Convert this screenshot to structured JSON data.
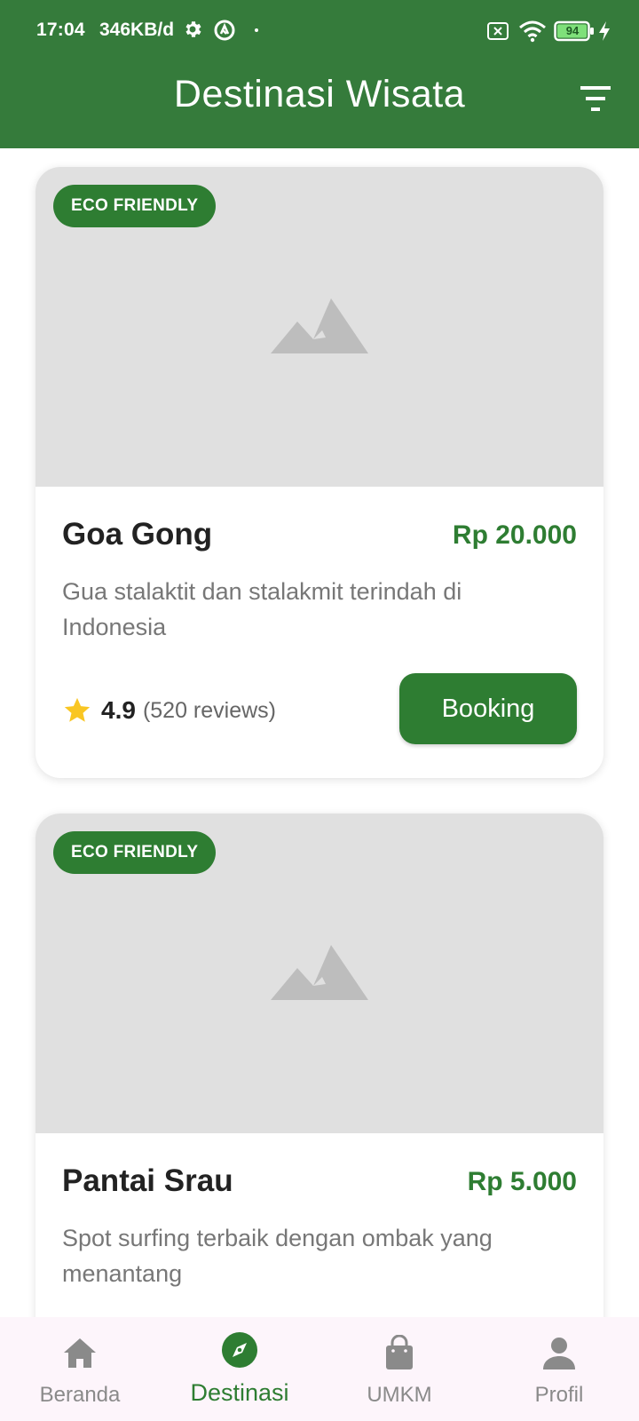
{
  "status_bar": {
    "time": "17:04",
    "speed": "346KB/d",
    "battery": "94"
  },
  "app_bar": {
    "title": "Destinasi Wisata",
    "filter_icon": "filter-list-icon",
    "color": "#357b3b"
  },
  "destinations": [
    {
      "badge": "ECO FRIENDLY",
      "name": "Goa Gong",
      "price": "Rp 20.000",
      "description": "Gua stalaktit dan stalakmit terindah di Indonesia",
      "rating": "4.9",
      "reviews": "(520 reviews)",
      "button": "Booking"
    },
    {
      "badge": "ECO FRIENDLY",
      "name": "Pantai Srau",
      "price": "Rp 5.000",
      "description": "Spot surfing terbaik dengan ombak yang menantang"
    }
  ],
  "bottom_nav": {
    "items": [
      {
        "label": "Beranda",
        "icon": "home-icon"
      },
      {
        "label": "Destinasi",
        "icon": "compass-icon",
        "active": true
      },
      {
        "label": "UMKM",
        "icon": "shopping-bag-icon"
      },
      {
        "label": "Profil",
        "icon": "person-icon"
      }
    ]
  },
  "colors": {
    "primary": "#2e7d32",
    "star": "#f9c623",
    "placeholder": "#e0e0e0"
  }
}
